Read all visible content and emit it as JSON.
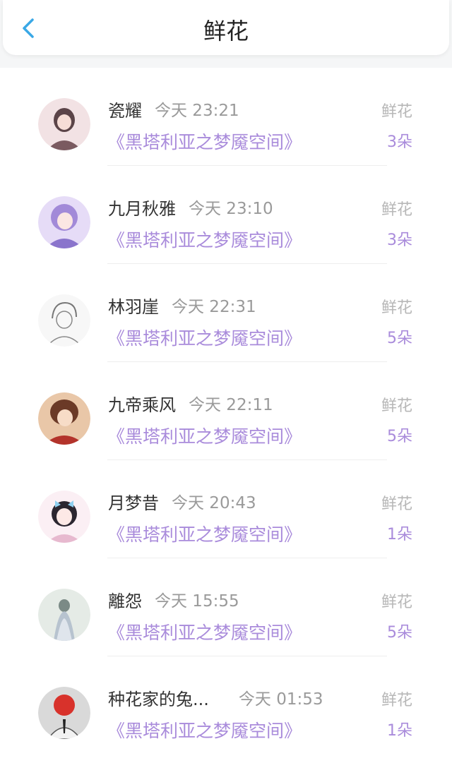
{
  "header": {
    "title": "鲜花"
  },
  "items": [
    {
      "name": "瓷耀",
      "time": "今天 23:21",
      "book": "《黑塔利亚之梦魇空间》",
      "gift_label": "鲜花",
      "count": "3朵",
      "avatar_color": "#d9a3a8"
    },
    {
      "name": "九月秋雅",
      "time": "今天 23:10",
      "book": "《黑塔利亚之梦魇空间》",
      "gift_label": "鲜花",
      "count": "3朵",
      "avatar_color": "#b9a6e8"
    },
    {
      "name": "林羽崖",
      "time": "今天 22:31",
      "book": "《黑塔利亚之梦魇空间》",
      "gift_label": "鲜花",
      "count": "5朵",
      "avatar_color": "#e9e9e9"
    },
    {
      "name": "九帝乘风",
      "time": "今天 22:11",
      "book": "《黑塔利亚之梦魇空间》",
      "gift_label": "鲜花",
      "count": "5朵",
      "avatar_color": "#d08a6a"
    },
    {
      "name": "月梦昔",
      "time": "今天 20:43",
      "book": "《黑塔利亚之梦魇空间》",
      "gift_label": "鲜花",
      "count": "1朵",
      "avatar_color": "#f1d6e4"
    },
    {
      "name": "離怨",
      "time": "今天 15:55",
      "book": "《黑塔利亚之梦魇空间》",
      "gift_label": "鲜花",
      "count": "5朵",
      "avatar_color": "#c9cfd6"
    },
    {
      "name": "种花家的兔...",
      "time": "今天 01:53",
      "book": "《黑塔利亚之梦魇空间》",
      "gift_label": "鲜花",
      "count": "1朵",
      "avatar_color": "#d8d8d8"
    }
  ]
}
